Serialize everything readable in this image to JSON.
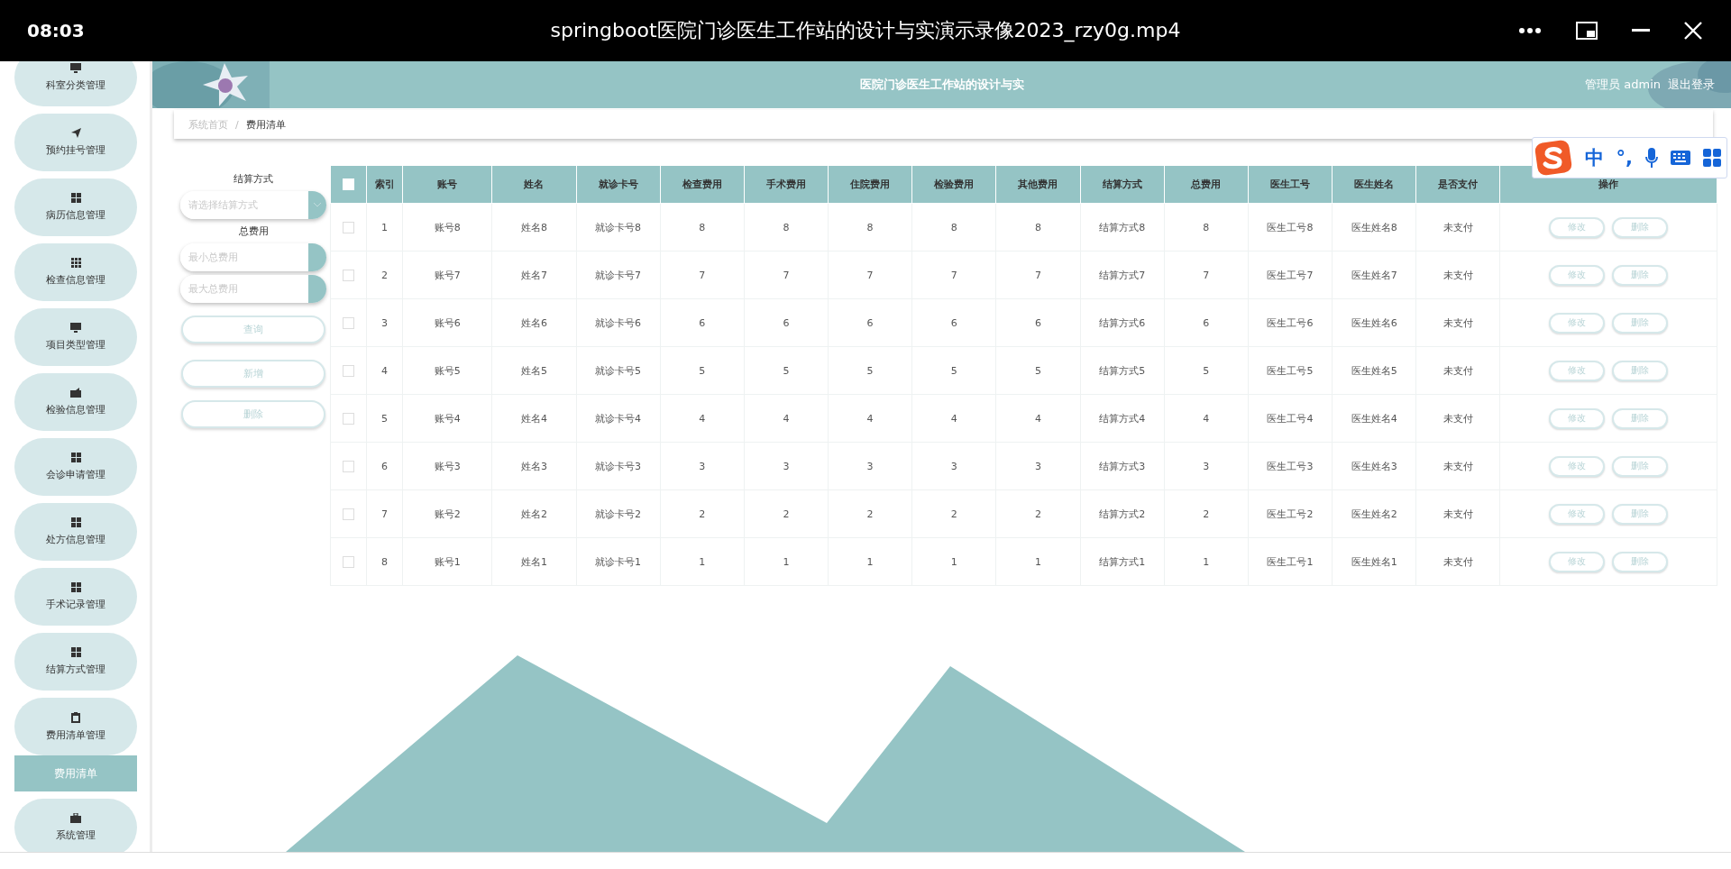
{
  "player": {
    "time": "08:03",
    "title": "springboot医院门诊医生工作站的设计与实演示录像2023_rzy0g.mp4"
  },
  "sidebar": {
    "items": [
      {
        "label": "科室分类管理",
        "kind": "monitor"
      },
      {
        "label": "预约挂号管理",
        "kind": "plane"
      },
      {
        "label": "病历信息管理",
        "kind": "grid"
      },
      {
        "label": "检查信息管理",
        "kind": "grid9"
      },
      {
        "label": "项目类型管理",
        "kind": "monitor"
      },
      {
        "label": "检验信息管理",
        "kind": "wallet"
      },
      {
        "label": "会诊申请管理",
        "kind": "grid"
      },
      {
        "label": "处方信息管理",
        "kind": "grid"
      },
      {
        "label": "手术记录管理",
        "kind": "grid"
      },
      {
        "label": "结算方式管理",
        "kind": "grid"
      },
      {
        "label": "费用清单管理",
        "kind": "clipboard",
        "children": [
          {
            "label": "费用清单",
            "selected": true
          }
        ]
      },
      {
        "label": "系统管理",
        "kind": "briefcase"
      }
    ]
  },
  "header": {
    "title": "医院门诊医生工作站的设计与实",
    "user": "管理员 admin",
    "logout": "退出登录"
  },
  "breadcrumb": [
    "系统首页",
    "/",
    "费用清单"
  ],
  "ime": {
    "mode": "中",
    "punct": "°,"
  },
  "filters": {
    "method_label": "结算方式",
    "method_placeholder": "请选择结算方式",
    "total_label": "总费用",
    "min_placeholder": "最小总费用",
    "max_placeholder": "最大总费用",
    "buttons": [
      "查询",
      "新增",
      "删除"
    ]
  },
  "table": {
    "all_checked": false,
    "columns": [
      "索引",
      "账号",
      "姓名",
      "就诊卡号",
      "检查费用",
      "手术费用",
      "住院费用",
      "检验费用",
      "其他费用",
      "结算方式",
      "总费用",
      "医生工号",
      "医生姓名",
      "是否支付",
      "操作"
    ],
    "rows": [
      {
        "checked": false,
        "cells": [
          "1",
          "账号8",
          "姓名8",
          "就诊卡号8",
          "8",
          "8",
          "8",
          "8",
          "8",
          "结算方式8",
          "8",
          "医生工号8",
          "医生姓名8",
          "未支付"
        ],
        "actions": [
          "修改",
          "删除"
        ]
      },
      {
        "checked": false,
        "cells": [
          "2",
          "账号7",
          "姓名7",
          "就诊卡号7",
          "7",
          "7",
          "7",
          "7",
          "7",
          "结算方式7",
          "7",
          "医生工号7",
          "医生姓名7",
          "未支付"
        ],
        "actions": [
          "修改",
          "删除"
        ]
      },
      {
        "checked": false,
        "cells": [
          "3",
          "账号6",
          "姓名6",
          "就诊卡号6",
          "6",
          "6",
          "6",
          "6",
          "6",
          "结算方式6",
          "6",
          "医生工号6",
          "医生姓名6",
          "未支付"
        ],
        "actions": [
          "修改",
          "删除"
        ]
      },
      {
        "checked": false,
        "cells": [
          "4",
          "账号5",
          "姓名5",
          "就诊卡号5",
          "5",
          "5",
          "5",
          "5",
          "5",
          "结算方式5",
          "5",
          "医生工号5",
          "医生姓名5",
          "未支付"
        ],
        "actions": [
          "修改",
          "删除"
        ]
      },
      {
        "checked": false,
        "cells": [
          "5",
          "账号4",
          "姓名4",
          "就诊卡号4",
          "4",
          "4",
          "4",
          "4",
          "4",
          "结算方式4",
          "4",
          "医生工号4",
          "医生姓名4",
          "未支付"
        ],
        "actions": [
          "修改",
          "删除"
        ]
      },
      {
        "checked": false,
        "cells": [
          "6",
          "账号3",
          "姓名3",
          "就诊卡号3",
          "3",
          "3",
          "3",
          "3",
          "3",
          "结算方式3",
          "3",
          "医生工号3",
          "医生姓名3",
          "未支付"
        ],
        "actions": [
          "修改",
          "删除"
        ]
      },
      {
        "checked": false,
        "cells": [
          "7",
          "账号2",
          "姓名2",
          "就诊卡号2",
          "2",
          "2",
          "2",
          "2",
          "2",
          "结算方式2",
          "2",
          "医生工号2",
          "医生姓名2",
          "未支付"
        ],
        "actions": [
          "修改",
          "删除"
        ]
      },
      {
        "checked": false,
        "cells": [
          "8",
          "账号1",
          "姓名1",
          "就诊卡号1",
          "1",
          "1",
          "1",
          "1",
          "1",
          "结算方式1",
          "1",
          "医生工号1",
          "医生姓名1",
          "未支付"
        ],
        "actions": [
          "修改",
          "删除"
        ]
      }
    ]
  }
}
